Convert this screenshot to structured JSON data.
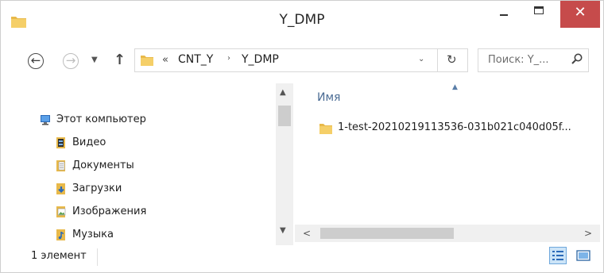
{
  "window": {
    "title": "Y_DMP",
    "minimize_icon": "minimize-icon",
    "maximize_icon": "maximize-icon",
    "close_label": "✕",
    "close_color": "#c64b4b"
  },
  "nav": {
    "back_glyph": "←",
    "forward_glyph": "→",
    "recent_glyph": "▼",
    "up_glyph": "↑"
  },
  "address": {
    "overflow": "«",
    "crumbs": [
      "CNT_Y",
      "Y_DMP"
    ],
    "separator": "›",
    "dropdown_glyph": "⌄",
    "refresh_glyph": "↻"
  },
  "search": {
    "placeholder": "Поиск: Y_..."
  },
  "sidebar": {
    "items": [
      {
        "label": "Этот компьютер",
        "icon": "computer-icon"
      },
      {
        "label": "Видео",
        "icon": "video-folder-icon"
      },
      {
        "label": "Документы",
        "icon": "documents-folder-icon"
      },
      {
        "label": "Загрузки",
        "icon": "downloads-folder-icon"
      },
      {
        "label": "Изображения",
        "icon": "pictures-folder-icon"
      },
      {
        "label": "Музыка",
        "icon": "music-folder-icon"
      }
    ]
  },
  "content": {
    "column_name": "Имя",
    "files": [
      {
        "name": "1-test-20210219113536-031b021c040d05f...",
        "icon": "folder-icon"
      }
    ]
  },
  "status": {
    "count": "1 элемент"
  },
  "colors": {
    "folder": "#e8b94a",
    "accent": "#4b6c94",
    "selection": "#cce4f7"
  }
}
